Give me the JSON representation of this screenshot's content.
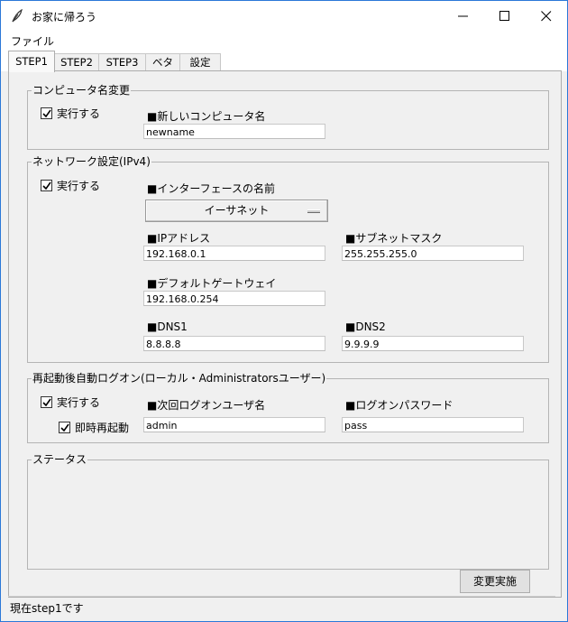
{
  "window": {
    "title": "お家に帰ろう"
  },
  "menu": {
    "items": [
      "ファイル"
    ]
  },
  "tabs": [
    {
      "label": "STEP1",
      "active": true
    },
    {
      "label": "STEP2",
      "active": false
    },
    {
      "label": "STEP3",
      "active": false
    },
    {
      "label": "ベタ",
      "active": false
    },
    {
      "label": "設定",
      "active": false
    }
  ],
  "computer_name": {
    "legend": "コンピュータ名変更",
    "execute_label": "実行する",
    "execute_checked": true,
    "new_name_label": "■新しいコンピュータ名",
    "new_name_value": "newname"
  },
  "network": {
    "legend": "ネットワーク設定(IPv4)",
    "execute_label": "実行する",
    "execute_checked": true,
    "interface_label": "■インターフェースの名前",
    "interface_value": "イーサネット",
    "ip_label": "■IPアドレス",
    "ip_value": "192.168.0.1",
    "subnet_label": "■サブネットマスク",
    "subnet_value": "255.255.255.0",
    "gateway_label": "■デフォルトゲートウェイ",
    "gateway_value": "192.168.0.254",
    "dns1_label": "■DNS1",
    "dns1_value": "8.8.8.8",
    "dns2_label": "■DNS2",
    "dns2_value": "9.9.9.9"
  },
  "autologon": {
    "legend": "再起動後自動ログオン(ローカル・Administratorsユーザー)",
    "execute_label": "実行する",
    "execute_checked": true,
    "reboot_label": "即時再起動",
    "reboot_checked": true,
    "user_label": "■次回ログオンユーザ名",
    "user_value": "admin",
    "password_label": "■ログオンパスワード",
    "password_value": "pass"
  },
  "status": {
    "legend": "ステータス",
    "text": ""
  },
  "actions": {
    "apply_label": "変更実施"
  },
  "statusbar": {
    "text": "現在step1です"
  }
}
